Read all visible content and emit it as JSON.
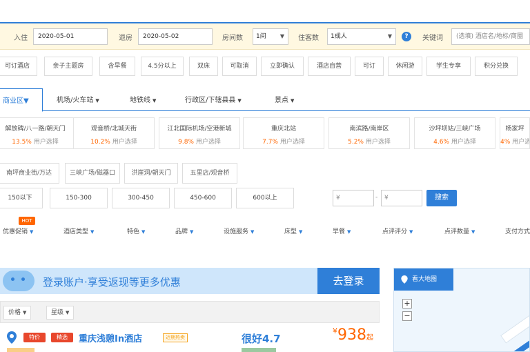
{
  "search": {
    "checkin_label": "入住",
    "checkin_value": "2020-05-01",
    "checkout_label": "退房",
    "checkout_value": "2020-05-02",
    "rooms_label": "房间数",
    "rooms_value": "1间",
    "guests_label": "住客数",
    "guests_value": "1成人",
    "keyword_label": "关键词",
    "keyword_value": "(选填) 酒店名/地标/商圈",
    "help_icon": "?"
  },
  "quick_chips": [
    "可订酒店",
    "亲子主题房",
    "含早餐",
    "4.5分以上",
    "双床",
    "可取消",
    "立即确认",
    "酒店自营",
    "可订",
    "休闲游",
    "学生专享",
    "积分兑换"
  ],
  "location_tabs": {
    "active": "商业区",
    "items": [
      "机场/火车站",
      "地铁线",
      "行政区/下辖县县",
      "景点"
    ]
  },
  "location_options": [
    {
      "name": "解放碑/八一路/朝天门",
      "pct": "13.5%",
      "suffix": "用户选择"
    },
    {
      "name": "观音桥/北城天街",
      "pct": "10.2%",
      "suffix": "用户选择"
    },
    {
      "name": "江北国际机场/空港新城",
      "pct": "9.8%",
      "suffix": "用户选择"
    },
    {
      "name": "重庆北站",
      "pct": "7.7%",
      "suffix": "用户选择"
    },
    {
      "name": "南滨路/南岸区",
      "pct": "5.2%",
      "suffix": "用户选择"
    },
    {
      "name": "沙坪坝站/三峡广场",
      "pct": "4.6%",
      "suffix": "用户选择"
    },
    {
      "name": "杨家坪",
      "pct": "4%",
      "suffix": "用户选择"
    }
  ],
  "sub_options": [
    "南坪商业街/万达",
    "三峡广场/磁器口",
    "洪崖洞/朝天门",
    "五里店/观音桥"
  ],
  "price_ranges": [
    "150以下",
    "150-300",
    "300-450",
    "450-600",
    "600以上"
  ],
  "price_min_placeholder": "¥",
  "price_max_placeholder": "¥",
  "price_dash": "-",
  "search_button": "搜索",
  "hot_badge": "HOT",
  "filters": [
    "优惠促销",
    "酒店类型",
    "特色",
    "品牌",
    "设施服务",
    "床型",
    "早餐",
    "点评评分",
    "点评数量",
    "支付方式"
  ],
  "promo": {
    "text": "登录账户·享受返现等更多优惠",
    "button": "去登录"
  },
  "sort": [
    "价格",
    "星级"
  ],
  "hotel": {
    "tag1": "特价",
    "tag2": "精选",
    "name": "重庆浅憩In酒店",
    "badge": "近期热卖",
    "score": "很好4.7",
    "currency": "¥",
    "price": "938",
    "price_suffix": "起"
  },
  "map": {
    "title": "看大地图",
    "zoom_in": "+",
    "zoom_out": "−"
  }
}
